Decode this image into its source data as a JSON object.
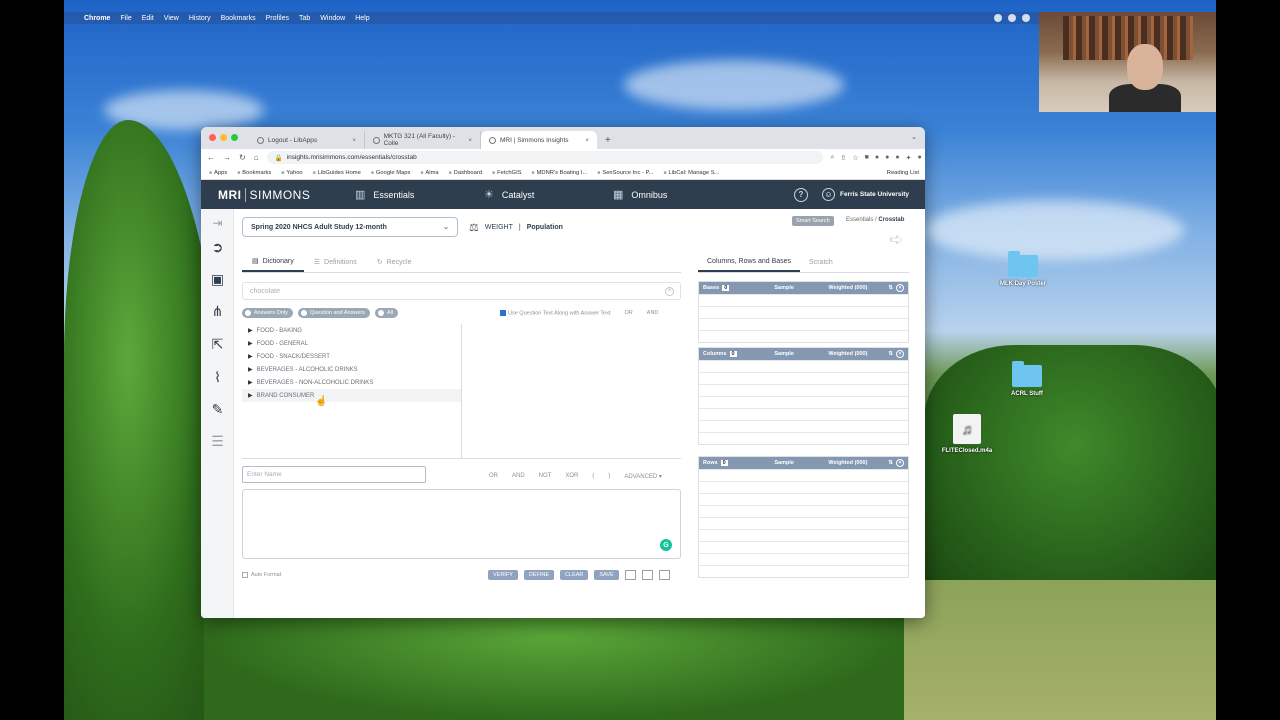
{
  "menubar": {
    "items": [
      "Chrome",
      "File",
      "Edit",
      "View",
      "History",
      "Bookmarks",
      "Profiles",
      "Tab",
      "Window",
      "Help"
    ]
  },
  "desktop": {
    "icons": [
      {
        "label": "MLK Day Poster",
        "kind": "folder"
      },
      {
        "label": "ACRL Stuff",
        "kind": "folder"
      },
      {
        "label": "FLITEClosed.m4a",
        "kind": "audio-file"
      }
    ]
  },
  "browser": {
    "tabs": [
      {
        "label": "Logout - LibApps",
        "active": false
      },
      {
        "label": "MKTG 321 (All Faculty) - Colle",
        "active": false
      },
      {
        "label": "MRI | Simmons Insights",
        "active": true
      }
    ],
    "url": "insights.mrisimmons.com/essentials/crosstab",
    "bookmarks": [
      "Apps",
      "Bookmarks",
      "Yahoo",
      "LibGuides Home",
      "Google Maps",
      "Alma",
      "Dashboard",
      "FetchGIS",
      "MDNR's Boating I...",
      "SenSource Inc - P...",
      "LibCal: Manage S..."
    ],
    "reading_list": "Reading List"
  },
  "app": {
    "logo_mri": "MRI",
    "logo_simmons": "SIMMONS",
    "nav": [
      "Essentials",
      "Catalyst",
      "Omnibus"
    ],
    "help_glyph": "?",
    "user_name": "Ferris State University",
    "study": "Spring 2020 NHCS Adult Study 12-month",
    "weight_label": "WEIGHT",
    "weight_sep": "|",
    "weight_value": "Population",
    "smart_search": "Smart Search",
    "breadcrumb_root": "Essentials /",
    "breadcrumb_current": "Crosstab",
    "dict_tabs": [
      "Dictionary",
      "Definitions",
      "Recycle"
    ],
    "search_value": "chocolate",
    "filters": [
      "Answers Only",
      "Question and Answers",
      "All"
    ],
    "use_text": "Use Question Text Along with Answer Text",
    "or_label": "OR",
    "and_label": "AND",
    "tree": [
      "FOOD - BAKING",
      "FOOD - GENERAL",
      "FOOD - SNACK/DESSERT",
      "BEVERAGES - ALCOHOLIC DRINKS",
      "BEVERAGES - NON-ALCOHOLIC DRINKS",
      "BRAND CONSUMER"
    ],
    "name_placeholder": "Enter Name",
    "operators": [
      "OR",
      "AND",
      "NOT",
      "XOR",
      "(",
      ")",
      "ADVANCED ▾"
    ],
    "auto_format": "Auto Format",
    "actions": [
      "VERIFY",
      "DEFINE",
      "CLEAR",
      "SAVE"
    ],
    "right_tabs": [
      "Columns, Rows and Bases",
      "Scratch"
    ],
    "panels": [
      {
        "title": "Bases",
        "count": "0",
        "sample": "Sample",
        "weighted": "Weighted (000)",
        "rows": 4
      },
      {
        "title": "Columns",
        "count": "0",
        "sample": "Sample",
        "weighted": "Weighted (000)",
        "rows": 7
      },
      {
        "title": "Rows",
        "count": "0",
        "sample": "Sample",
        "weighted": "Weighted (000)",
        "rows": 9
      }
    ]
  }
}
